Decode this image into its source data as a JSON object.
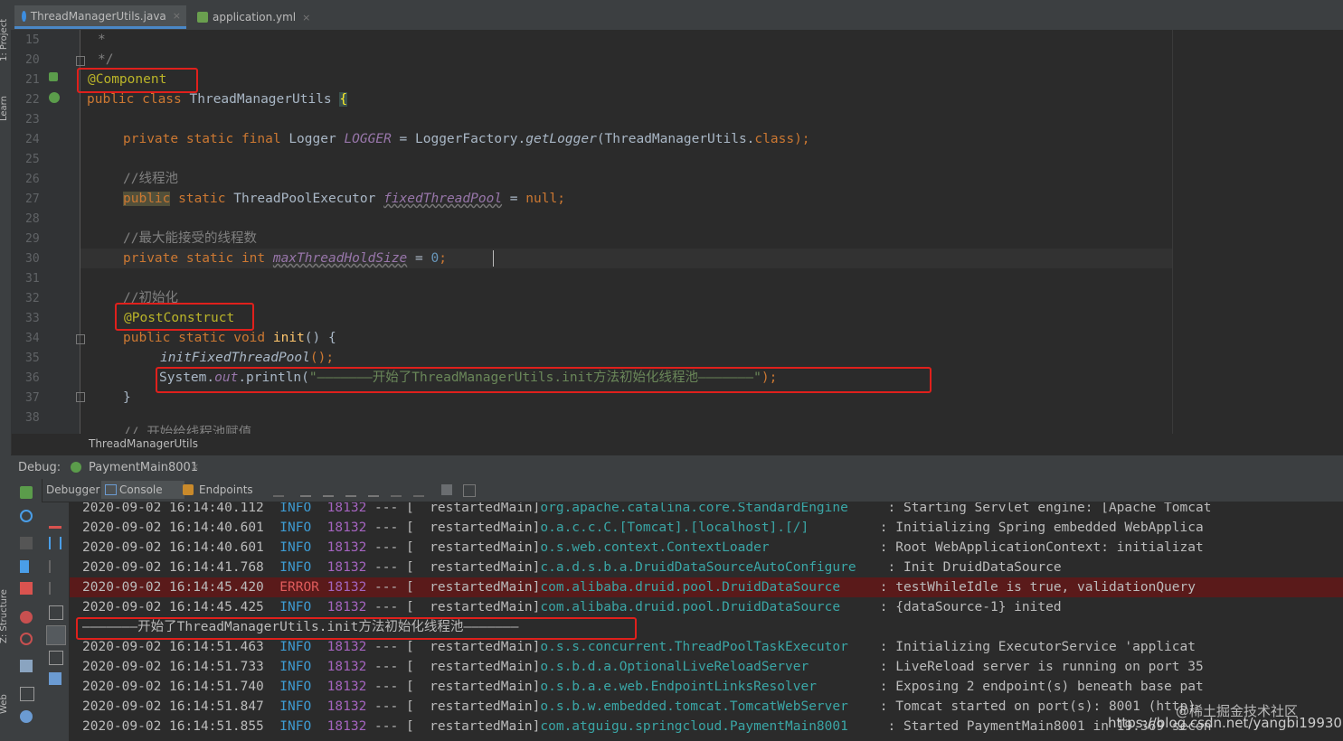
{
  "side_labels": {
    "project": "1: Project",
    "learn": "Learn",
    "structure": "Z: Structure",
    "web": "Web"
  },
  "tabs": [
    {
      "label": "ThreadManagerUtils.java"
    },
    {
      "label": "application.yml"
    }
  ],
  "close_glyph": "×",
  "line_numbers": [
    "15",
    "20",
    "21",
    "22",
    "23",
    "24",
    "25",
    "26",
    "27",
    "28",
    "29",
    "30",
    "31",
    "32",
    "33",
    "34",
    "35",
    "36",
    "37",
    "38"
  ],
  "code": {
    "l15": "*",
    "l20": "*/",
    "l21": "@Component",
    "l22_kw": "public class ",
    "l22_name": "ThreadManagerUtils ",
    "l22_brace": "{",
    "l24_kw": "private static final ",
    "l24_type": "Logger ",
    "l24_field": "LOGGER",
    "l24_eq": " = LoggerFactory.",
    "l24_method": "getLogger",
    "l24_arg": "(ThreadManagerUtils.",
    "l24_class": "class",
    "l24_end": ");",
    "l26": "//线程池",
    "l27_public": "public",
    "l27_static": " static ",
    "l27_type": "ThreadPoolExecutor ",
    "l27_field": "fixedThreadPool",
    "l27_eq": " = ",
    "l27_null": "null",
    "l27_end": ";",
    "l29": "//最大能接受的线程数",
    "l30_kw": "private static int ",
    "l30_field": "maxThreadHoldSize",
    "l30_eq": " = ",
    "l30_num": "0",
    "l30_end": ";",
    "l32": "//初始化",
    "l33": "@PostConstruct",
    "l34_kw": "public static void ",
    "l34_name": "init",
    "l34_end": "() {",
    "l35": "initFixedThreadPool",
    "l35_end": "();",
    "l36_a": "System.",
    "l36_out": "out",
    "l36_b": ".println(",
    "l36_str": "\"———————开始了ThreadManagerUtils.init方法初始化线程池———————\"",
    "l36_end": ");",
    "l37": "}",
    "l38": "// 开始给线程池赋值"
  },
  "breadcrumb": "ThreadManagerUtils",
  "debug": {
    "label": "Debug:",
    "run_config": "PaymentMain8001",
    "tabs": [
      "Debugger",
      "Console",
      "Endpoints"
    ]
  },
  "console_lines": [
    {
      "ts": "2020-09-02 16:14:40.112",
      "level": "INFO",
      "pid": "18132",
      "sep": " --- [",
      "thread": "  restartedMain]",
      "logger": "org.apache.catalina.core.StandardEngine    ",
      "msg": " : Starting Servlet engine: [Apache Tomcat"
    },
    {
      "ts": "2020-09-02 16:14:40.601",
      "level": "INFO",
      "pid": "18132",
      "sep": " --- [",
      "thread": "  restartedMain]",
      "logger": "o.a.c.c.C.[Tomcat].[localhost].[/]        ",
      "msg": " : Initializing Spring embedded WebApplica"
    },
    {
      "ts": "2020-09-02 16:14:40.601",
      "level": "INFO",
      "pid": "18132",
      "sep": " --- [",
      "thread": "  restartedMain]",
      "logger": "o.s.web.context.ContextLoader             ",
      "msg": " : Root WebApplicationContext: initializat"
    },
    {
      "ts": "2020-09-02 16:14:41.768",
      "level": "INFO",
      "pid": "18132",
      "sep": " --- [",
      "thread": "  restartedMain]",
      "logger": "c.a.d.s.b.a.DruidDataSourceAutoConfigure   ",
      "msg": " : Init DruidDataSource"
    },
    {
      "ts": "2020-09-02 16:14:45.420",
      "level": "ERROR",
      "pid": "18132",
      "sep": " --- [",
      "thread": "  restartedMain]",
      "logger": "com.alibaba.druid.pool.DruidDataSource    ",
      "msg": " : testWhileIdle is true, validationQuery"
    },
    {
      "ts": "2020-09-02 16:14:45.425",
      "level": "INFO",
      "pid": "18132",
      "sep": " --- [",
      "thread": "  restartedMain]",
      "logger": "com.alibaba.druid.pool.DruidDataSource    ",
      "msg": " : {dataSource-1} inited"
    },
    {
      "plain": "———————开始了ThreadManagerUtils.init方法初始化线程池———————"
    },
    {
      "ts": "2020-09-02 16:14:51.463",
      "level": "INFO",
      "pid": "18132",
      "sep": " --- [",
      "thread": "  restartedMain]",
      "logger": "o.s.s.concurrent.ThreadPoolTaskExecutor   ",
      "msg": " : Initializing ExecutorService 'applicat"
    },
    {
      "ts": "2020-09-02 16:14:51.733",
      "level": "INFO",
      "pid": "18132",
      "sep": " --- [",
      "thread": "  restartedMain]",
      "logger": "o.s.b.d.a.OptionalLiveReloadServer        ",
      "msg": " : LiveReload server is running on port 35"
    },
    {
      "ts": "2020-09-02 16:14:51.740",
      "level": "INFO",
      "pid": "18132",
      "sep": " --- [",
      "thread": "  restartedMain]",
      "logger": "o.s.b.a.e.web.EndpointLinksResolver       ",
      "msg": " : Exposing 2 endpoint(s) beneath base pat"
    },
    {
      "ts": "2020-09-02 16:14:51.847",
      "level": "INFO",
      "pid": "18132",
      "sep": " --- [",
      "thread": "  restartedMain]",
      "logger": "o.s.b.w.embedded.tomcat.TomcatWebServer   ",
      "msg": " : Tomcat started on port(s): 8001 (http)"
    },
    {
      "ts": "2020-09-02 16:14:51.855",
      "level": "INFO",
      "pid": "18132",
      "sep": " --- [",
      "thread": "  restartedMain]",
      "logger": "com.atguigu.springcloud.PaymentMain8001    ",
      "msg": " : Started PaymentMain8001 in 19.369 secon"
    }
  ],
  "watermark": {
    "line1": "@稀土掘金技术社区",
    "line2": "https://blog.csdn.net/yangbi199307"
  },
  "colors": {
    "keyword": "#cc7832",
    "annotation": "#bbb529",
    "comment": "#808080",
    "string": "#6a8759",
    "field": "#9876aa",
    "info": "#3e9bd2",
    "error": "#e05c5c",
    "highlight_box": "#e0201c"
  }
}
